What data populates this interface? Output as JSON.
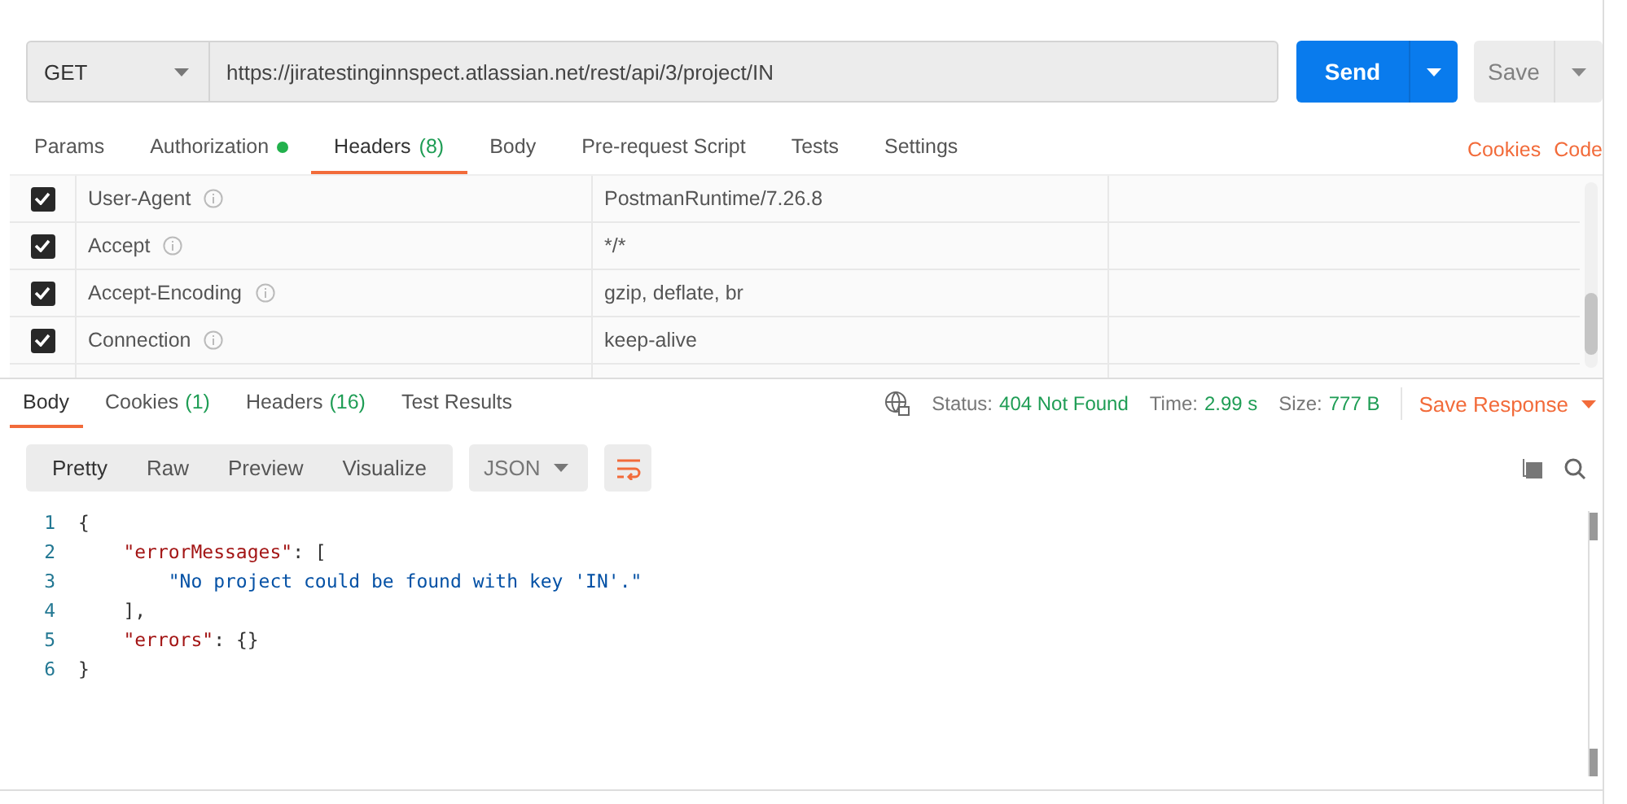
{
  "request": {
    "method": "GET",
    "url": "https://jiratestinginnspect.atlassian.net/rest/api/3/project/IN",
    "send": "Send",
    "save": "Save"
  },
  "request_tabs": [
    {
      "label": "Params",
      "selected": false,
      "dot": false
    },
    {
      "label": "Authorization",
      "selected": false,
      "dot": true
    },
    {
      "label": "Headers",
      "count": "(8)",
      "selected": true,
      "dot": false
    },
    {
      "label": "Body",
      "selected": false,
      "dot": false
    },
    {
      "label": "Pre-request Script",
      "selected": false,
      "dot": false
    },
    {
      "label": "Tests",
      "selected": false,
      "dot": false
    },
    {
      "label": "Settings",
      "selected": false,
      "dot": false
    }
  ],
  "request_links": [
    "Cookies",
    "Code"
  ],
  "headers": [
    {
      "key": "User-Agent",
      "value": "PostmanRuntime/7.26.8",
      "checked": true
    },
    {
      "key": "Accept",
      "value": "*/*",
      "checked": true
    },
    {
      "key": "Accept-Encoding",
      "value": "gzip, deflate, br",
      "checked": true
    },
    {
      "key": "Connection",
      "value": "keep-alive",
      "checked": true
    }
  ],
  "response_tabs": [
    {
      "label": "Body",
      "selected": true
    },
    {
      "label": "Cookies",
      "count": "(1)",
      "selected": false
    },
    {
      "label": "Headers",
      "count": "(16)",
      "selected": false
    },
    {
      "label": "Test Results",
      "selected": false
    }
  ],
  "response_meta": [
    {
      "label": "Status:",
      "value": "404 Not Found"
    },
    {
      "label": "Time:",
      "value": "2.99 s"
    },
    {
      "label": "Size:",
      "value": "777 B"
    }
  ],
  "save_response": "Save Response",
  "view_modes": [
    {
      "label": "Pretty",
      "selected": true
    },
    {
      "label": "Raw",
      "selected": false
    },
    {
      "label": "Preview",
      "selected": false
    },
    {
      "label": "Visualize",
      "selected": false
    }
  ],
  "format": "JSON",
  "code_lines": [
    {
      "number": "1",
      "tokens": [
        {
          "kind": "punct",
          "text": "{"
        }
      ]
    },
    {
      "number": "2",
      "tokens": [
        {
          "kind": "key",
          "text": "    \"errorMessages\""
        },
        {
          "kind": "punct",
          "text": ": ["
        }
      ]
    },
    {
      "number": "3",
      "tokens": [
        {
          "kind": "string",
          "text": "        \"No project could be found with key 'IN'.\""
        }
      ]
    },
    {
      "number": "4",
      "tokens": [
        {
          "kind": "punct",
          "text": "    ],"
        }
      ]
    },
    {
      "number": "5",
      "tokens": [
        {
          "kind": "key",
          "text": "    \"errors\""
        },
        {
          "kind": "punct",
          "text": ": {}"
        }
      ]
    },
    {
      "number": "6",
      "tokens": [
        {
          "kind": "punct",
          "text": "}"
        }
      ]
    }
  ]
}
